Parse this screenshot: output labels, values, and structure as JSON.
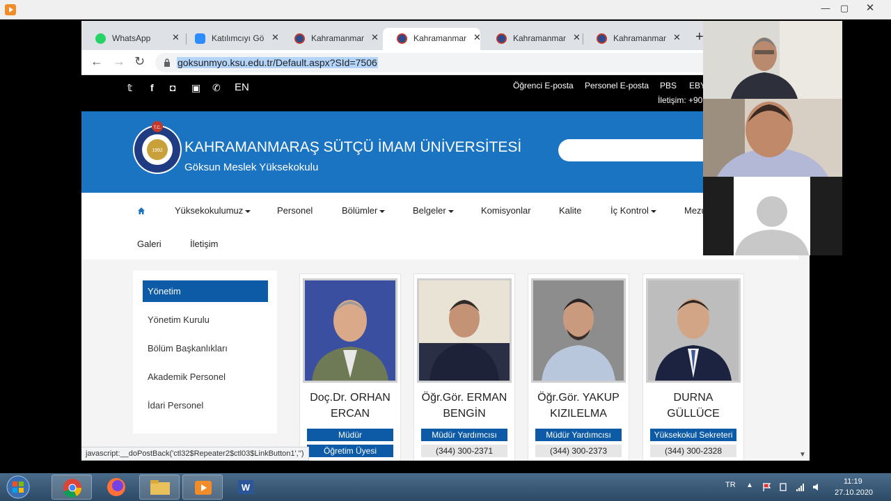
{
  "browser": {
    "tabs": [
      {
        "label": "WhatsApp",
        "fav": "whatsapp-icon"
      },
      {
        "label": "Katılımcıyı Görü",
        "fav": "zoom-icon"
      },
      {
        "label": "Kahramanmaraş",
        "fav": "ksu-icon"
      },
      {
        "label": "Kahramanmaraş",
        "fav": "ksu-icon",
        "active": true
      },
      {
        "label": "Kahramanmaraş",
        "fav": "ksu-icon"
      },
      {
        "label": "Kahramanmaraş",
        "fav": "ksu-icon"
      }
    ],
    "new_tab": "+",
    "url": "goksunmyo.ksu.edu.tr/Default.aspx?SId=7506",
    "status_text": "javascript:__doPostBack('ctl32$Repeater2$ctl03$LinkButton1','')"
  },
  "site": {
    "topbar": {
      "lang": "EN",
      "links": [
        "Öğrenci E-posta",
        "Personel E-posta",
        "PBS",
        "EBY"
      ],
      "contact": "İletişim: +90"
    },
    "banner": {
      "university": "KAHRAMANMARAŞ SÜTÇÜ İMAM ÜNİVERSİTESİ",
      "school": "Göksun Meslek Yüksekokulu",
      "logo_year": "1992",
      "logo_tc": "T.C."
    },
    "nav": [
      {
        "label": "Yüksekokulumuz",
        "dropdown": true
      },
      {
        "label": "Personel",
        "dropdown": false
      },
      {
        "label": "Bölümler",
        "dropdown": true
      },
      {
        "label": "Belgeler",
        "dropdown": true
      },
      {
        "label": "Komisyonlar",
        "dropdown": false
      },
      {
        "label": "Kalite",
        "dropdown": false
      },
      {
        "label": "İç Kontrol",
        "dropdown": true
      },
      {
        "label": "Mezu",
        "dropdown": false
      },
      {
        "label": "Galeri",
        "dropdown": false
      },
      {
        "label": "İletişim",
        "dropdown": false
      }
    ],
    "side_menu": [
      "Yönetim",
      "Yönetim Kurulu",
      "Bölüm Başkanlıkları",
      "Akademik Personel",
      "İdari Personel"
    ],
    "people": [
      {
        "name1": "Doç.Dr. ORHAN",
        "name2": "ERCAN",
        "role": "Müdür",
        "sub": "Öğretim Üyesi",
        "sub_type": "blue"
      },
      {
        "name1": "Öğr.Gör. ERMAN",
        "name2": "BENGİN",
        "role": "Müdür Yardımcısı",
        "sub": "(344) 300-2371",
        "sub_type": "phone"
      },
      {
        "name1": "Öğr.Gör. YAKUP",
        "name2": "KIZILELMA",
        "role": "Müdür Yardımcısı",
        "sub": "(344) 300-2373",
        "sub_type": "phone"
      },
      {
        "name1": "DURNA",
        "name2": "GÜLLÜCE",
        "role": "Yüksekokul Sekreteri",
        "sub": "(344) 300-2328",
        "sub_type": "phone"
      }
    ]
  },
  "taskbar": {
    "lang": "TR",
    "time": "11:19",
    "date": "27.10.2020"
  },
  "colors": {
    "banner_blue": "#1a74c2",
    "badge_blue": "#0d5aa7",
    "topbar_black": "#000000"
  }
}
